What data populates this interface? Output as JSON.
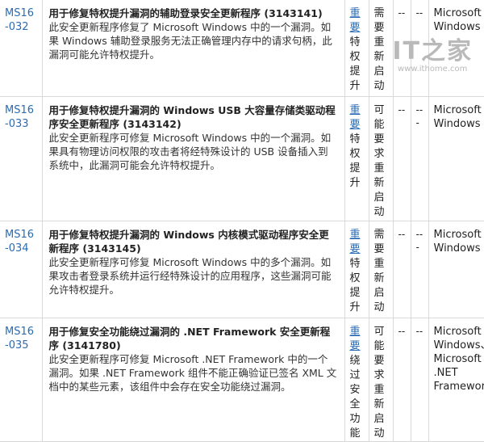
{
  "bulletins": [
    {
      "id": "MS16-032",
      "title": "用于修复特权提升漏洞的辅助登录安全更新程序 (3143141)",
      "description": "此安全更新程序修复了 Microsoft Windows 中的一个漏洞。如果 Windows 辅助登录服务无法正确管理内存中的请求句柄，此漏洞可能允许特权提升。",
      "severity": "重要",
      "impact": "特权提升",
      "restart": "需要重新启动",
      "col5": "--",
      "col6": "--",
      "software": "Microsoft Windows"
    },
    {
      "id": "MS16-033",
      "title": "用于修复特权提升漏洞的 Windows USB 大容量存储类驱动程序安全更新程序 (3143142)",
      "description": "此安全更新程序可修复 Microsoft Windows 中的一个漏洞。如果具有物理访问权限的攻击者将经特殊设计的 USB 设备插入到系统中，此漏洞可能会允许特权提升。",
      "severity": "重要",
      "impact": "特权提升",
      "restart": "可能要求重新启动",
      "col5": "--",
      "col6": "---",
      "software": "Microsoft Windows"
    },
    {
      "id": "MS16-034",
      "title": "用于修复特权提升漏洞的 Windows 内核模式驱动程序安全更新程序 (3143145)",
      "description": "此安全更新程序可修复 Microsoft Windows 中的多个漏洞。如果攻击者登录系统并运行经特殊设计的应用程序，这些漏洞可能允许特权提升。",
      "severity": "重要",
      "impact": "特权提升",
      "restart": "需要重新启动",
      "col5": "--",
      "col6": "---",
      "software": "Microsoft Windows"
    },
    {
      "id": "MS16-035",
      "title": "用于修复安全功能绕过漏洞的 .NET Framework 安全更新程序 (3141780)",
      "description": "此安全更新程序可修复 Microsoft .NET Framework 中的一个漏洞。如果 .NET Framework 组件不能正确验证已签名 XML 文档中的某些元素，该组件中会存在安全功能绕过漏洞。",
      "severity": "重要",
      "impact": "绕过安全功能",
      "restart": "可能要求重新启动",
      "col5": "--",
      "col6": "--",
      "software": "Microsoft Windows、Microsoft .NET Framework"
    }
  ],
  "watermark": {
    "logo": "IT之家",
    "url": "www.ithome.com"
  },
  "colors": {
    "link": "#2a6cb3",
    "border": "#d9d9d9",
    "watermark": "#b9b9b9"
  }
}
